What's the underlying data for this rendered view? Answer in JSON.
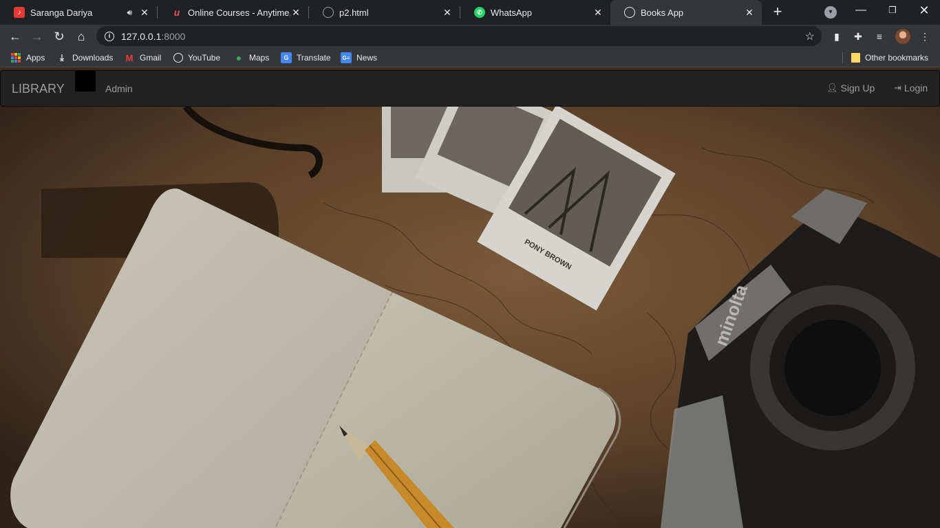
{
  "browser": {
    "tabs": [
      {
        "title": "Saranga Dariya",
        "favicon_color": "#e53935",
        "audio": true
      },
      {
        "title": "Online Courses - Anytime, Anywhere",
        "favicon_color": "#ec5252"
      },
      {
        "title": "p2.html",
        "favicon_color": "#9aa0a6"
      },
      {
        "title": "WhatsApp",
        "favicon_color": "#25d366"
      },
      {
        "title": "Books App",
        "favicon_color": "#e8eaed",
        "active": true
      }
    ],
    "address": {
      "host": "127.0.0.1",
      "port": ":8000"
    },
    "bookmarks": [
      {
        "label": "Apps",
        "icon": "apps-grid-icon"
      },
      {
        "label": "Downloads",
        "icon": "download-icon"
      },
      {
        "label": "Gmail",
        "icon": "gmail-icon"
      },
      {
        "label": "YouTube",
        "icon": "globe-icon"
      },
      {
        "label": "Maps",
        "icon": "maps-pin-icon"
      },
      {
        "label": "Translate",
        "icon": "translate-icon"
      },
      {
        "label": "News",
        "icon": "news-icon"
      }
    ],
    "other_bookmarks": "Other bookmarks"
  },
  "site": {
    "brand": "LIBRARY",
    "nav_admin": "Admin",
    "signup": "Sign Up",
    "login": "Login"
  },
  "hero": {
    "description_icon": "notebook-map-camera-photo",
    "photo_caption": "PONY BROWN"
  },
  "colors": {
    "navbar_bg": "#222222",
    "navbar_text": "#9d9d9d",
    "chrome_dark": "#202124",
    "chrome_toolbar": "#35363a"
  }
}
